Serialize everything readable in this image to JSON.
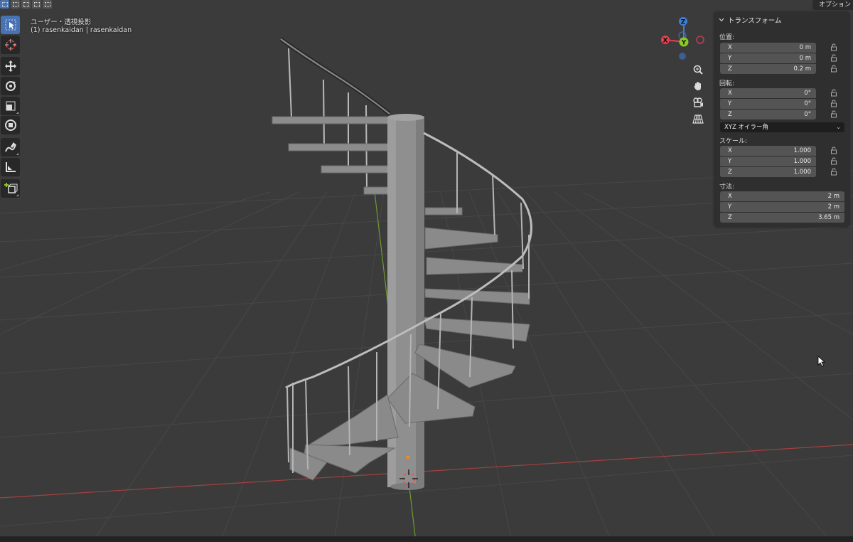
{
  "viewport": {
    "header_line1": "ユーザー・透視投影",
    "header_line2": "(1) rasenkaidan | rasenkaidan",
    "options_label": "オプション",
    "background_color": "#3b3b3b",
    "grid_color": "#444444",
    "x_axis_color": "#b34545",
    "y_axis_color": "#6f9a2e"
  },
  "toolbar": {
    "tools": [
      {
        "name": "select-box-tool",
        "icon": "cursor-arrow-icon",
        "active": true
      },
      {
        "name": "3d-cursor-tool",
        "icon": "crosshair-circle-icon",
        "active": false
      },
      {
        "name": "move-tool",
        "icon": "move-arrows-icon",
        "active": false
      },
      {
        "name": "rotate-tool",
        "icon": "rotate-icon",
        "active": false
      },
      {
        "name": "scale-tool",
        "icon": "scale-icon",
        "active": false
      },
      {
        "name": "transform-tool",
        "icon": "transform-icon",
        "active": false
      },
      {
        "name": "annotate-tool",
        "icon": "pencil-icon",
        "active": false
      },
      {
        "name": "measure-tool",
        "icon": "ruler-icon",
        "active": false
      },
      {
        "name": "add-cube-tool",
        "icon": "add-cube-icon",
        "active": false
      }
    ]
  },
  "gizmo": {
    "x_label": "X",
    "y_label": "Y",
    "z_label": "Z",
    "x_color": "#e0424f",
    "y_color": "#8bc925",
    "z_color": "#3f7fd6"
  },
  "nav_buttons": [
    "zoom-icon",
    "hand-pan-icon",
    "camera-icon",
    "grid-icon"
  ],
  "transform_panel": {
    "title": "トランスフォーム",
    "location": {
      "label": "位置:",
      "x": {
        "label": "X",
        "value": "0 m"
      },
      "y": {
        "label": "Y",
        "value": "0 m"
      },
      "z": {
        "label": "Z",
        "value": "0.2 m"
      }
    },
    "rotation": {
      "label": "回転:",
      "x": {
        "label": "X",
        "value": "0°"
      },
      "y": {
        "label": "Y",
        "value": "0°"
      },
      "z": {
        "label": "Z",
        "value": "0°"
      },
      "mode": "XYZ オイラー角"
    },
    "scale": {
      "label": "スケール:",
      "x": {
        "label": "X",
        "value": "1.000"
      },
      "y": {
        "label": "Y",
        "value": "1.000"
      },
      "z": {
        "label": "Z",
        "value": "1.000"
      }
    },
    "dimensions": {
      "label": "寸法:",
      "x": {
        "label": "X",
        "value": "2 m"
      },
      "y": {
        "label": "Y",
        "value": "2 m"
      },
      "z": {
        "label": "Z",
        "value": "3.65 m"
      }
    }
  }
}
